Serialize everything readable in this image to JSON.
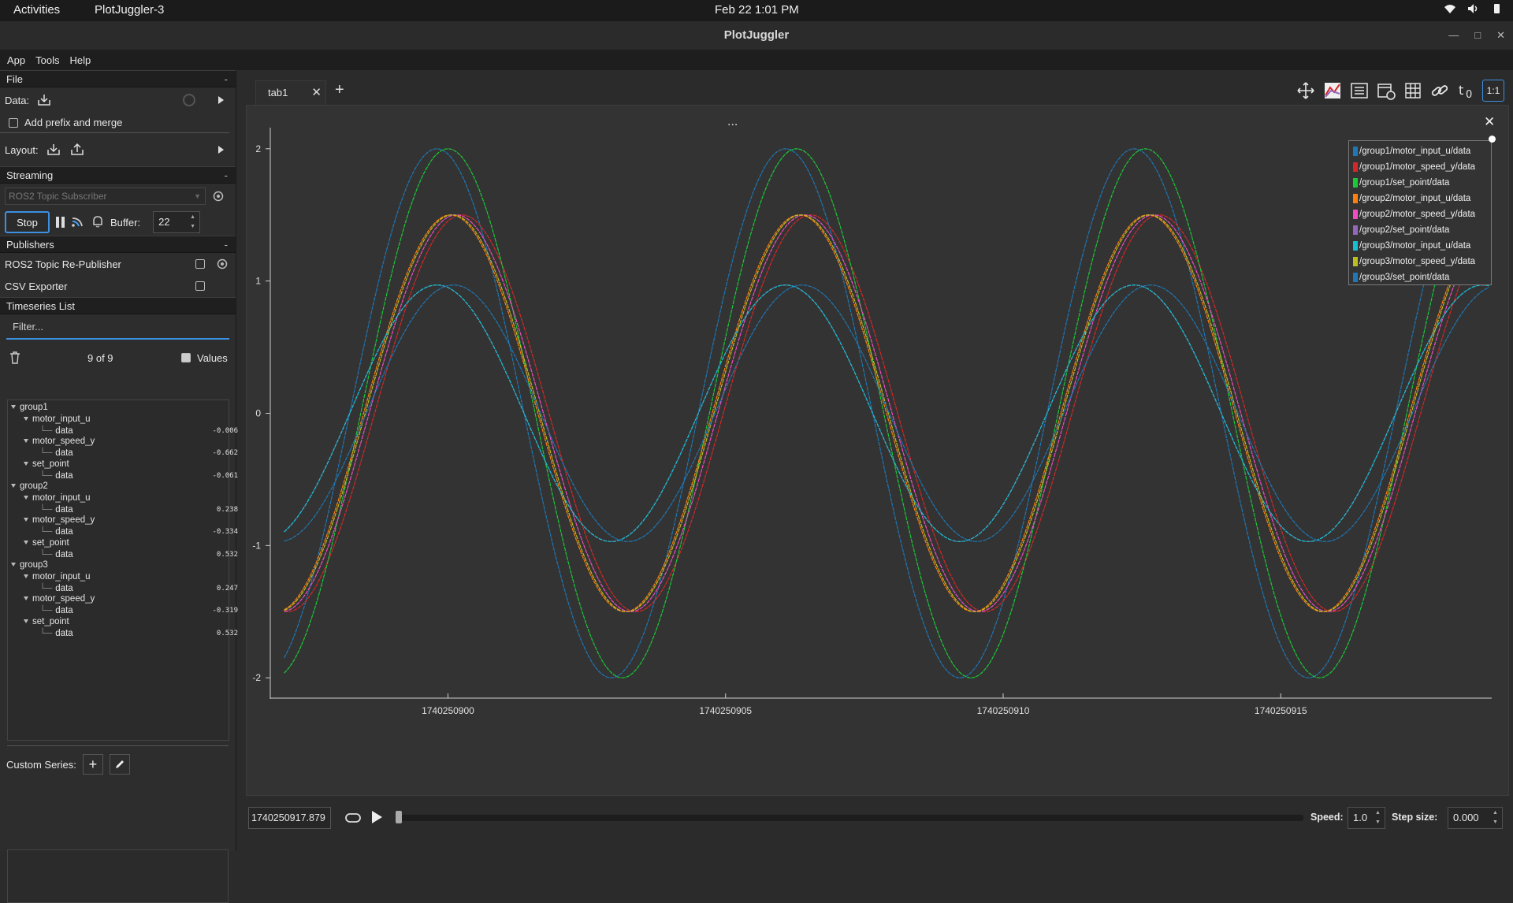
{
  "topbar": {
    "activities": "Activities",
    "app": "PlotJuggler-3",
    "clock": "Feb 22  1:01 PM"
  },
  "window": {
    "title": "PlotJuggler"
  },
  "menu": [
    "App",
    "Tools",
    "Help"
  ],
  "file_section": {
    "title": "File",
    "data_label": "Data:",
    "prefix_label": "Add prefix and merge",
    "layout_label": "Layout:"
  },
  "streaming": {
    "title": "Streaming",
    "source": "ROS2 Topic Subscriber",
    "stop_label": "Stop",
    "buffer_label": "Buffer:",
    "buffer_value": "22"
  },
  "publishers": {
    "title": "Publishers",
    "items": [
      "ROS2 Topic Re-Publisher",
      "CSV Exporter"
    ]
  },
  "timeseries": {
    "title": "Timeseries List",
    "filter_placeholder": "Filter...",
    "count": "9 of 9",
    "values_label": "Values"
  },
  "tree": [
    {
      "group": "group1",
      "items": [
        {
          "name": "motor_input_u",
          "leaf": "data",
          "value": "-0.006"
        },
        {
          "name": "motor_speed_y",
          "leaf": "data",
          "value": "-0.662"
        },
        {
          "name": "set_point",
          "leaf": "data",
          "value": "-0.061"
        }
      ]
    },
    {
      "group": "group2",
      "items": [
        {
          "name": "motor_input_u",
          "leaf": "data",
          "value": "0.238"
        },
        {
          "name": "motor_speed_y",
          "leaf": "data",
          "value": "-0.334"
        },
        {
          "name": "set_point",
          "leaf": "data",
          "value": "0.532"
        }
      ]
    },
    {
      "group": "group3",
      "items": [
        {
          "name": "motor_input_u",
          "leaf": "data",
          "value": "0.247"
        },
        {
          "name": "motor_speed_y",
          "leaf": "data",
          "value": "-0.319"
        },
        {
          "name": "set_point",
          "leaf": "data",
          "value": "0.532"
        }
      ]
    }
  ],
  "custom_series_label": "Custom Series:",
  "tabs": [
    {
      "label": "tab1"
    }
  ],
  "plot": {
    "title_dots": "...",
    "legend": [
      {
        "name": "/group1/motor_input_u/data",
        "color": "#1f77b4"
      },
      {
        "name": "/group1/motor_speed_y/data",
        "color": "#d62728"
      },
      {
        "name": "/group1/set_point/data",
        "color": "#1ac938"
      },
      {
        "name": "/group2/motor_input_u/data",
        "color": "#ff7f0e"
      },
      {
        "name": "/group2/motor_speed_y/data",
        "color": "#f14cc1"
      },
      {
        "name": "/group2/set_point/data",
        "color": "#9467bd"
      },
      {
        "name": "/group3/motor_input_u/data",
        "color": "#17becf"
      },
      {
        "name": "/group3/motor_speed_y/data",
        "color": "#bcbd22"
      },
      {
        "name": "/group3/set_point/data",
        "color": "#1f77b4"
      }
    ]
  },
  "chart_data": {
    "type": "line",
    "xlabel": "",
    "ylabel": "",
    "xlim": [
      1740250896.8,
      1740250918.8
    ],
    "ylim": [
      -2.1,
      2.1
    ],
    "x_ticks": [
      "1740250900",
      "1740250905",
      "1740250910",
      "1740250915"
    ],
    "x_tick_values": [
      1740250900,
      1740250905,
      1740250910,
      1740250915
    ],
    "y_ticks": [
      2,
      1,
      0,
      -1,
      -2
    ],
    "series": [
      {
        "name": "/group1/motor_input_u/data",
        "color": "#1f77b4",
        "amplitude": 2.0,
        "period": 6.28,
        "phase": 0.0
      },
      {
        "name": "/group1/motor_speed_y/data",
        "color": "#d62728",
        "amplitude": 1.5,
        "period": 6.28,
        "phase": 0.45
      },
      {
        "name": "/group1/set_point/data",
        "color": "#1ac938",
        "amplitude": 2.0,
        "period": 6.28,
        "phase": 0.2
      },
      {
        "name": "/group2/motor_input_u/data",
        "color": "#ff7f0e",
        "amplitude": 1.5,
        "period": 6.28,
        "phase": 0.25
      },
      {
        "name": "/group2/motor_speed_y/data",
        "color": "#f14cc1",
        "amplitude": 1.5,
        "period": 6.28,
        "phase": 0.35
      },
      {
        "name": "/group2/set_point/data",
        "color": "#9467bd",
        "amplitude": 0.97,
        "period": 6.28,
        "phase": 0.0
      },
      {
        "name": "/group3/motor_input_u/data",
        "color": "#17becf",
        "amplitude": 0.97,
        "period": 6.28,
        "phase": 0.0
      },
      {
        "name": "/group3/motor_speed_y/data",
        "color": "#bcbd22",
        "amplitude": 1.5,
        "period": 6.28,
        "phase": 0.28
      },
      {
        "name": "/group3/set_point/data",
        "color": "#1f77b4",
        "amplitude": 0.97,
        "period": 6.28,
        "phase": 0.3
      }
    ]
  },
  "player": {
    "time": "1740250917.879",
    "speed_label": "Speed:",
    "speed_value": "1.0",
    "step_label": "Step size:",
    "step_value": "0.000"
  }
}
